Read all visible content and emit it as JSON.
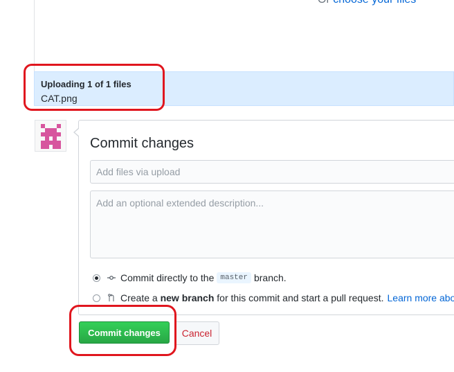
{
  "dropzone": {
    "or_text": "Or",
    "choose_link": "choose your files"
  },
  "upload_status": {
    "title": "Uploading 1 of 1 files",
    "filename": "CAT.png"
  },
  "commit_form": {
    "title": "Commit changes",
    "summary_placeholder": "Add files via upload",
    "description_placeholder": "Add an optional extended description...",
    "option_direct": {
      "prefix": "Commit directly to the",
      "branch": "master",
      "suffix": "branch.",
      "selected": true,
      "icon": "git-commit-icon"
    },
    "option_new_branch": {
      "prefix": "Create a",
      "bold": "new branch",
      "suffix": "for this commit and start a pull request.",
      "link": "Learn more abo",
      "selected": false,
      "icon": "git-pull-request-icon"
    }
  },
  "buttons": {
    "commit": "Commit changes",
    "cancel": "Cancel"
  },
  "colors": {
    "commit_button": "#28a745",
    "cancel_text": "#cb2431",
    "link": "#0366d6",
    "upload_bar": "#dbedff",
    "annotation": "#e0161e",
    "avatar": "#d7559e"
  }
}
